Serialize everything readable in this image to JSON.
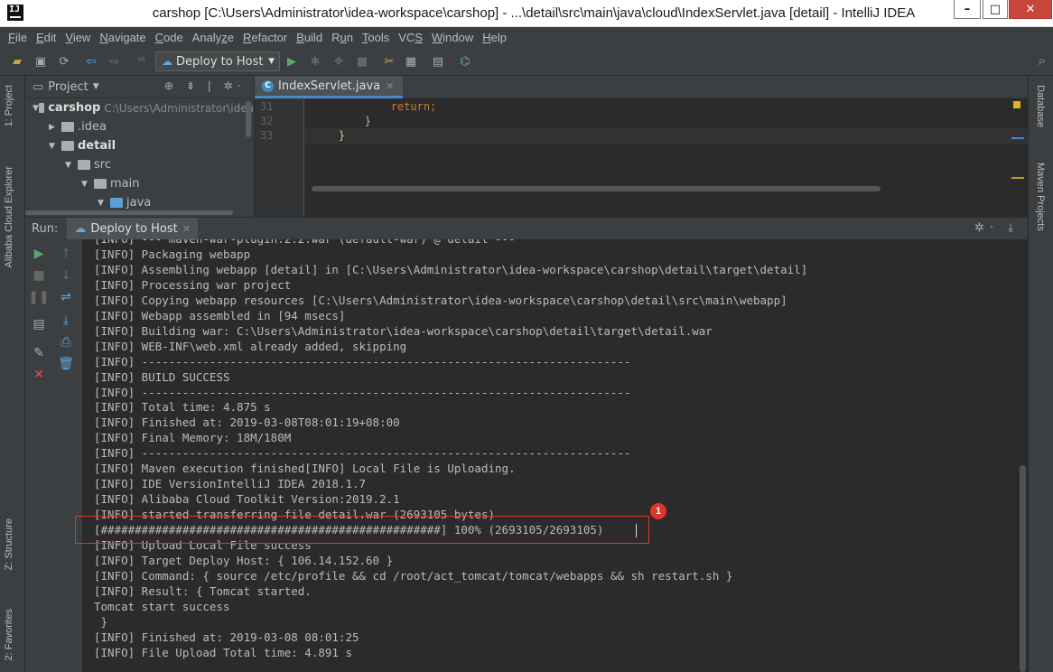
{
  "window": {
    "title": "carshop [C:\\Users\\Administrator\\idea-workspace\\carshop] - ...\\detail\\src\\main\\java\\cloud\\IndexServlet.java [detail] - IntelliJ IDEA",
    "minimize": "–",
    "maximize": "□",
    "close": "✕"
  },
  "menu": [
    {
      "u": "F",
      "rest": "ile"
    },
    {
      "u": "E",
      "rest": "dit"
    },
    {
      "u": "V",
      "rest": "iew"
    },
    {
      "u": "N",
      "rest": "avigate"
    },
    {
      "u": "C",
      "rest": "ode"
    },
    {
      "pre": "Analy",
      "u": "z",
      "rest": "e"
    },
    {
      "u": "R",
      "rest": "efactor"
    },
    {
      "u": "B",
      "rest": "uild"
    },
    {
      "pre": "R",
      "u": "u",
      "rest": "n"
    },
    {
      "u": "T",
      "rest": "ools"
    },
    {
      "pre": "VC",
      "u": "S",
      "rest": ""
    },
    {
      "u": "W",
      "rest": "indow"
    },
    {
      "u": "H",
      "rest": "elp"
    }
  ],
  "toolbar": {
    "run_config": "Deploy to Host"
  },
  "left_stripe": {
    "project": "1: Project",
    "alibaba": "Alibaba Cloud Explorer",
    "structure": "Z: Structure",
    "favorites": "2: Favorites"
  },
  "right_stripe": {
    "database": "Database",
    "maven": "Maven Projects"
  },
  "project": {
    "header": "Project",
    "tree": [
      {
        "label": "carshop",
        "path": "C:\\Users\\Administrator\\idea",
        "indent": 0,
        "expanded": true,
        "bold": true
      },
      {
        "label": ".idea",
        "indent": 1,
        "expanded": false
      },
      {
        "label": "detail",
        "indent": 1,
        "expanded": true,
        "bold": true
      },
      {
        "label": "src",
        "indent": 2,
        "expanded": true
      },
      {
        "label": "main",
        "indent": 3,
        "expanded": true
      },
      {
        "label": "java",
        "indent": 4,
        "expanded": true,
        "blue": true
      }
    ]
  },
  "editor": {
    "tab": "IndexServlet.java",
    "lines": [
      {
        "num": "31",
        "code": "            return;"
      },
      {
        "num": "32",
        "code": "        }"
      },
      {
        "num": "33",
        "code": "    }"
      }
    ]
  },
  "run": {
    "label": "Run:",
    "tab": "Deploy to Host",
    "console": [
      "[INFO] --- maven-war-plugin:2.2:war (default-war) @ detail ---",
      "[INFO] Packaging webapp",
      "[INFO] Assembling webapp [detail] in [C:\\Users\\Administrator\\idea-workspace\\carshop\\detail\\target\\detail]",
      "[INFO] Processing war project",
      "[INFO] Copying webapp resources [C:\\Users\\Administrator\\idea-workspace\\carshop\\detail\\src\\main\\webapp]",
      "[INFO] Webapp assembled in [94 msecs]",
      "[INFO] Building war: C:\\Users\\Administrator\\idea-workspace\\carshop\\detail\\target\\detail.war",
      "[INFO] WEB-INF\\web.xml already added, skipping",
      "[INFO] ------------------------------------------------------------------------",
      "[INFO] BUILD SUCCESS",
      "[INFO] ------------------------------------------------------------------------",
      "[INFO] Total time: 4.875 s",
      "[INFO] Finished at: 2019-03-08T08:01:19+08:00",
      "[INFO] Final Memory: 18M/180M",
      "[INFO] ------------------------------------------------------------------------",
      "[INFO] Maven execution finished[INFO] Local File is Uploading.",
      "[INFO] IDE VersionIntelliJ IDEA 2018.1.7",
      "[INFO] Alibaba Cloud Toolkit Version:2019.2.1",
      "[INFO] started transferring file detail.war (2693105 bytes)",
      "[##################################################] 100% (2693105/2693105)",
      "[INFO] Upload Local File success",
      "[INFO] Target Deploy Host: { 106.14.152.60 }",
      "[INFO] Command: { source /etc/profile && cd /root/act_tomcat/tomcat/webapps && sh restart.sh }",
      "[INFO] Result: { Tomcat started.",
      "Tomcat start success",
      " }",
      "[INFO] Finished at: 2019-03-08 08:01:25",
      "[INFO] File Upload Total time: 4.891 s"
    ]
  },
  "annotation": {
    "badge": "1"
  },
  "colors": {
    "annotation": "#e0352b",
    "keyword": "#cc7832",
    "accent": "#4a88c7"
  }
}
